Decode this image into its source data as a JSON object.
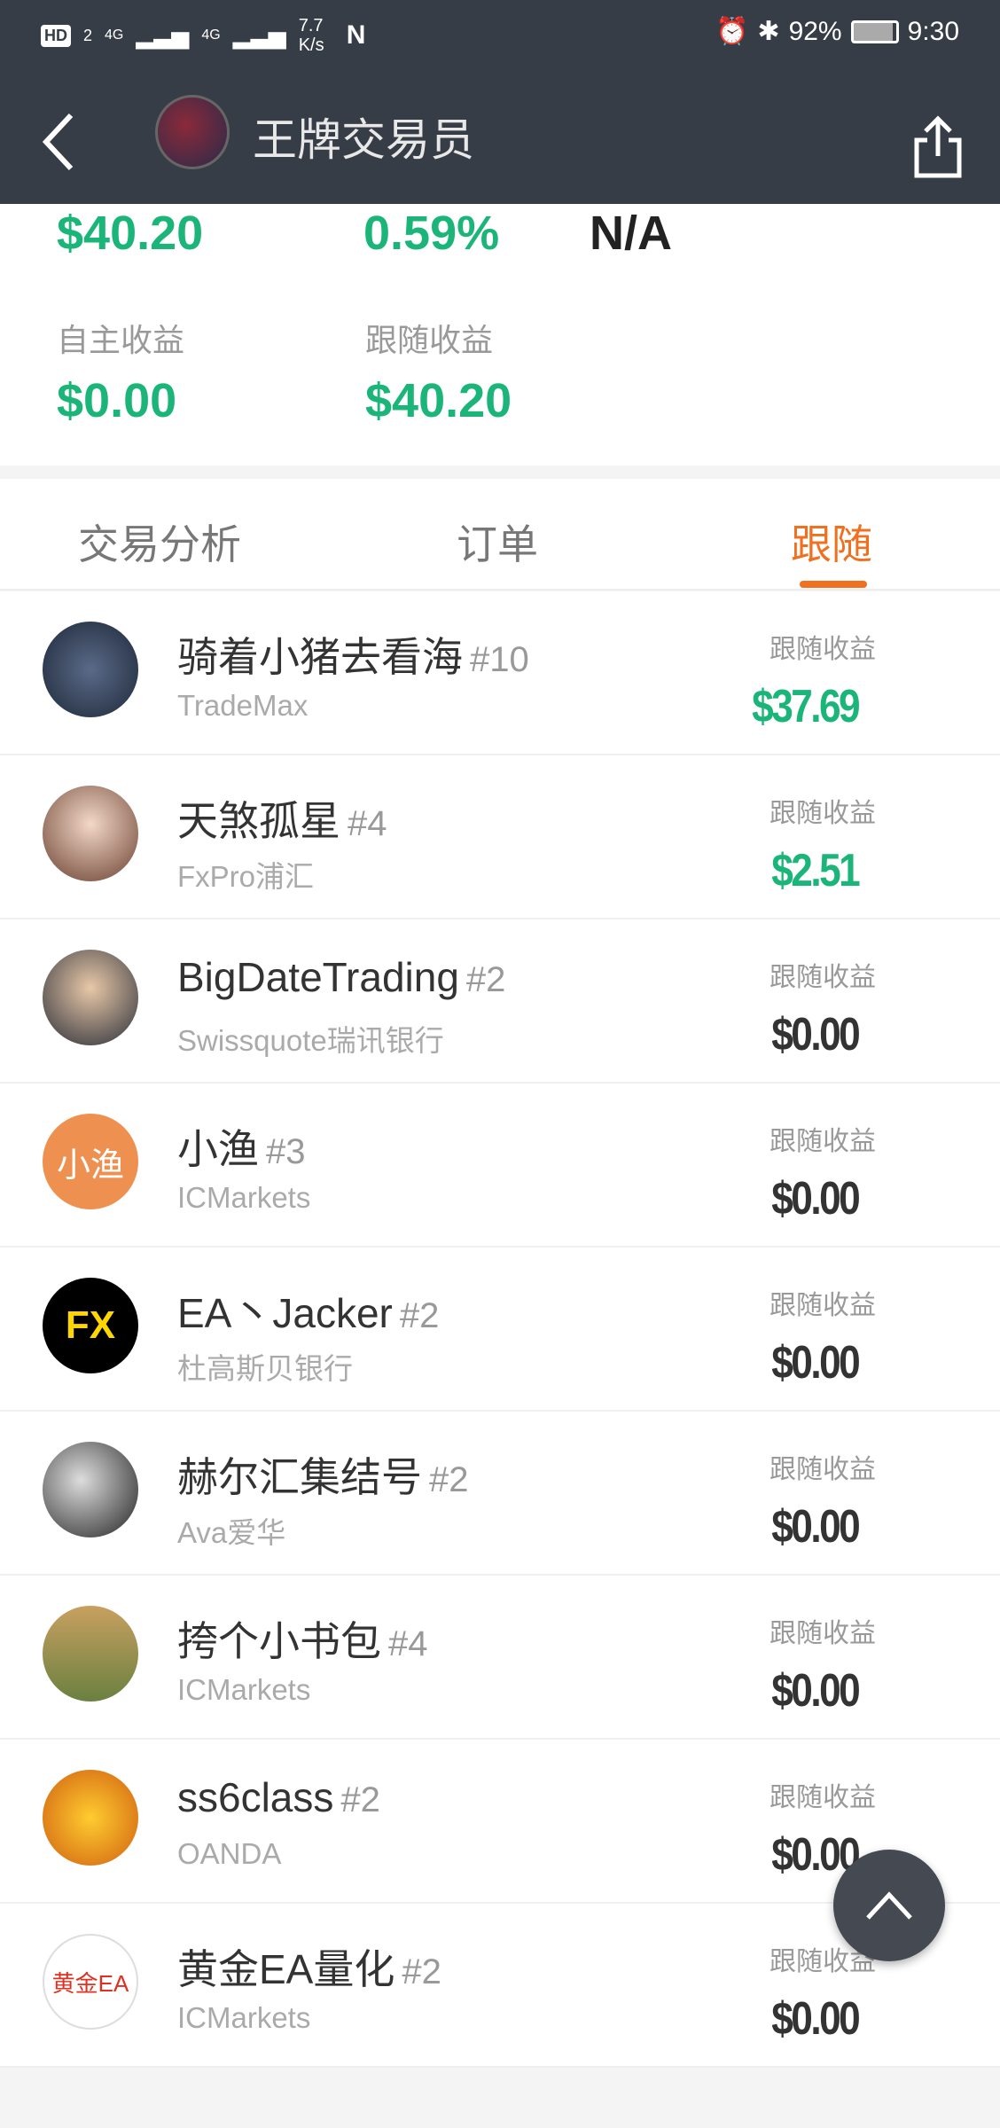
{
  "status_bar": {
    "left": [
      "HD",
      "2",
      "4G",
      "4G",
      "7.7 K/s",
      "N"
    ],
    "battery": "92%",
    "time": "9:30"
  },
  "header": {
    "title": "王牌交易员"
  },
  "stats_top": {
    "v1": "$40.20",
    "v2": "0.59%",
    "v3": "N/A"
  },
  "stats": [
    {
      "label": "自主收益",
      "value": "$0.00"
    },
    {
      "label": "跟随收益",
      "value": "$40.20"
    }
  ],
  "tabs": [
    {
      "label": "交易分析"
    },
    {
      "label": "订单"
    },
    {
      "label": "跟随",
      "active": true
    }
  ],
  "colors": {
    "accent": "#f07020",
    "positive": "#1bb57a",
    "header": "#373d47"
  },
  "followers": [
    {
      "name": "骑着小猪去看海",
      "rank": "#10",
      "broker": "TradeMax",
      "label": "跟随收益",
      "value": "$37.69",
      "positive": true
    },
    {
      "name": "天煞孤星",
      "rank": "#4",
      "broker": "FxPro浦汇",
      "label": "跟随收益",
      "value": "$2.51",
      "positive": true
    },
    {
      "name": "BigDateTrading",
      "rank": "#2",
      "broker": "Swissquote瑞讯银行",
      "label": "跟随收益",
      "value": "$0.00"
    },
    {
      "name": "小渔",
      "rank": "#3",
      "broker": "ICMarkets",
      "label": "跟随收益",
      "value": "$0.00",
      "avatar_text": "小渔"
    },
    {
      "name": "EA丶Jacker",
      "rank": "#2",
      "broker": "杜高斯贝银行",
      "label": "跟随收益",
      "value": "$0.00",
      "avatar_text": "FX"
    },
    {
      "name": "赫尔汇集结号",
      "rank": "#2",
      "broker": "Ava爱华",
      "label": "跟随收益",
      "value": "$0.00"
    },
    {
      "name": "挎个小书包",
      "rank": "#4",
      "broker": "ICMarkets",
      "label": "跟随收益",
      "value": "$0.00"
    },
    {
      "name": "ss6class",
      "rank": "#2",
      "broker": "OANDA",
      "label": "跟随收益",
      "value": "$0.00"
    },
    {
      "name": "黄金EA量化",
      "rank": "#2",
      "broker": "ICMarkets",
      "label": "跟随收益",
      "value": "$0.00",
      "avatar_text": "黄金EA"
    }
  ]
}
